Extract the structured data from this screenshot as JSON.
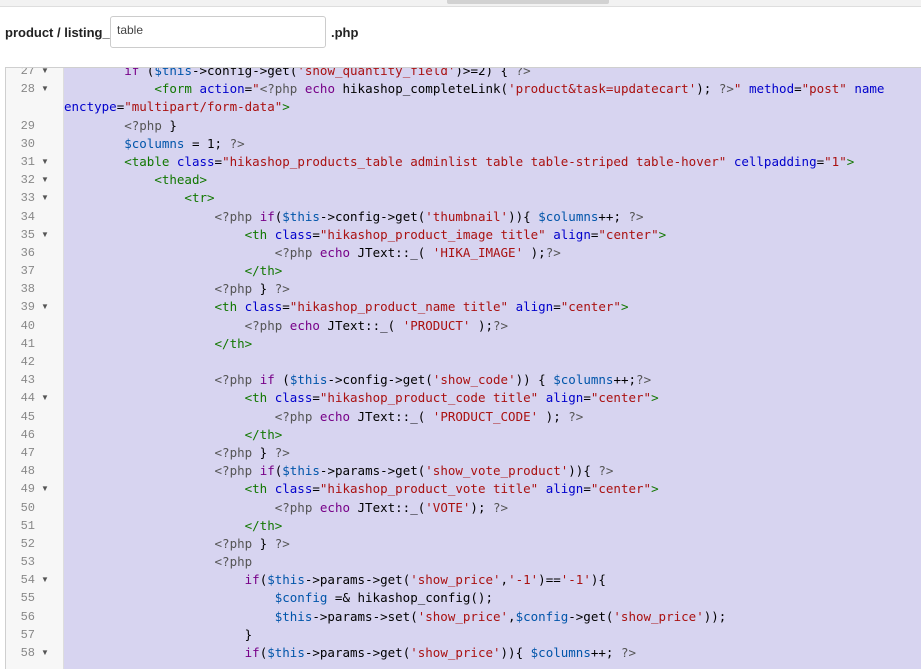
{
  "path": {
    "prefix": "product / listing_",
    "input_value": "table",
    "suffix": ".php"
  },
  "editor": {
    "lines": [
      {
        "num": "27",
        "fold": true,
        "segments": [
          [
            "plain",
            "        "
          ],
          [
            "kw",
            "if"
          ],
          [
            "plain",
            " ("
          ],
          [
            "var",
            "$this"
          ],
          [
            "plain",
            "->config->get("
          ],
          [
            "str",
            "'show_quantity_field'"
          ],
          [
            "plain",
            ")>=2) { "
          ],
          [
            "meta",
            "?>"
          ]
        ]
      },
      {
        "num": "28",
        "fold": true,
        "segments": [
          [
            "plain",
            "            "
          ],
          [
            "tag",
            "<form"
          ],
          [
            "plain",
            " "
          ],
          [
            "attr",
            "action"
          ],
          [
            "plain",
            "="
          ],
          [
            "str",
            "\""
          ],
          [
            "meta",
            "<?php"
          ],
          [
            "plain",
            " "
          ],
          [
            "kw",
            "echo"
          ],
          [
            "plain",
            " hikashop_completeLink("
          ],
          [
            "str",
            "'product&task=updatecart'"
          ],
          [
            "plain",
            "); "
          ],
          [
            "meta",
            "?>"
          ],
          [
            "str",
            "\""
          ],
          [
            "plain",
            " "
          ],
          [
            "attr",
            "method"
          ],
          [
            "plain",
            "="
          ],
          [
            "str",
            "\"post\""
          ],
          [
            "plain",
            " "
          ],
          [
            "attr",
            "name"
          ]
        ]
      },
      {
        "num": "",
        "fold": false,
        "segments": [
          [
            "attr",
            "enctype"
          ],
          [
            "plain",
            "="
          ],
          [
            "str",
            "\"multipart/form-data\""
          ],
          [
            "tag",
            ">"
          ]
        ]
      },
      {
        "num": "29",
        "fold": false,
        "segments": [
          [
            "plain",
            "        "
          ],
          [
            "meta",
            "<?php"
          ],
          [
            "plain",
            " }"
          ]
        ]
      },
      {
        "num": "30",
        "fold": false,
        "segments": [
          [
            "plain",
            "        "
          ],
          [
            "var",
            "$columns"
          ],
          [
            "plain",
            " = 1; "
          ],
          [
            "meta",
            "?>"
          ]
        ]
      },
      {
        "num": "31",
        "fold": true,
        "segments": [
          [
            "plain",
            "        "
          ],
          [
            "tag",
            "<table"
          ],
          [
            "plain",
            " "
          ],
          [
            "attr",
            "class"
          ],
          [
            "plain",
            "="
          ],
          [
            "str",
            "\"hikashop_products_table adminlist table table-striped table-hover\""
          ],
          [
            "plain",
            " "
          ],
          [
            "attr",
            "cellpadding"
          ],
          [
            "plain",
            "="
          ],
          [
            "str",
            "\"1\""
          ],
          [
            "tag",
            ">"
          ]
        ]
      },
      {
        "num": "32",
        "fold": true,
        "segments": [
          [
            "plain",
            "            "
          ],
          [
            "tag",
            "<thead>"
          ]
        ]
      },
      {
        "num": "33",
        "fold": true,
        "segments": [
          [
            "plain",
            "                "
          ],
          [
            "tag",
            "<tr>"
          ]
        ]
      },
      {
        "num": "34",
        "fold": false,
        "segments": [
          [
            "plain",
            "                    "
          ],
          [
            "meta",
            "<?php"
          ],
          [
            "plain",
            " "
          ],
          [
            "kw",
            "if"
          ],
          [
            "plain",
            "("
          ],
          [
            "var",
            "$this"
          ],
          [
            "plain",
            "->config->get("
          ],
          [
            "str",
            "'thumbnail'"
          ],
          [
            "plain",
            ")){ "
          ],
          [
            "var",
            "$columns"
          ],
          [
            "plain",
            "++; "
          ],
          [
            "meta",
            "?>"
          ]
        ]
      },
      {
        "num": "35",
        "fold": true,
        "segments": [
          [
            "plain",
            "                        "
          ],
          [
            "tag",
            "<th"
          ],
          [
            "plain",
            " "
          ],
          [
            "attr",
            "class"
          ],
          [
            "plain",
            "="
          ],
          [
            "str",
            "\"hikashop_product_image title\""
          ],
          [
            "plain",
            " "
          ],
          [
            "attr",
            "align"
          ],
          [
            "plain",
            "="
          ],
          [
            "str",
            "\"center\""
          ],
          [
            "tag",
            ">"
          ]
        ]
      },
      {
        "num": "36",
        "fold": false,
        "segments": [
          [
            "plain",
            "                            "
          ],
          [
            "meta",
            "<?php"
          ],
          [
            "plain",
            " "
          ],
          [
            "kw",
            "echo"
          ],
          [
            "plain",
            " JText::_( "
          ],
          [
            "str",
            "'HIKA_IMAGE'"
          ],
          [
            "plain",
            " );"
          ],
          [
            "meta",
            "?>"
          ]
        ]
      },
      {
        "num": "37",
        "fold": false,
        "segments": [
          [
            "plain",
            "                        "
          ],
          [
            "tag",
            "</th>"
          ]
        ]
      },
      {
        "num": "38",
        "fold": false,
        "segments": [
          [
            "plain",
            "                    "
          ],
          [
            "meta",
            "<?php"
          ],
          [
            "plain",
            " } "
          ],
          [
            "meta",
            "?>"
          ]
        ]
      },
      {
        "num": "39",
        "fold": true,
        "segments": [
          [
            "plain",
            "                    "
          ],
          [
            "tag",
            "<th"
          ],
          [
            "plain",
            " "
          ],
          [
            "attr",
            "class"
          ],
          [
            "plain",
            "="
          ],
          [
            "str",
            "\"hikashop_product_name title\""
          ],
          [
            "plain",
            " "
          ],
          [
            "attr",
            "align"
          ],
          [
            "plain",
            "="
          ],
          [
            "str",
            "\"center\""
          ],
          [
            "tag",
            ">"
          ]
        ]
      },
      {
        "num": "40",
        "fold": false,
        "segments": [
          [
            "plain",
            "                        "
          ],
          [
            "meta",
            "<?php"
          ],
          [
            "plain",
            " "
          ],
          [
            "kw",
            "echo"
          ],
          [
            "plain",
            " JText::_( "
          ],
          [
            "str",
            "'PRODUCT'"
          ],
          [
            "plain",
            " );"
          ],
          [
            "meta",
            "?>"
          ]
        ]
      },
      {
        "num": "41",
        "fold": false,
        "segments": [
          [
            "plain",
            "                    "
          ],
          [
            "tag",
            "</th>"
          ]
        ]
      },
      {
        "num": "42",
        "fold": false,
        "segments": []
      },
      {
        "num": "43",
        "fold": false,
        "segments": [
          [
            "plain",
            "                    "
          ],
          [
            "meta",
            "<?php"
          ],
          [
            "plain",
            " "
          ],
          [
            "kw",
            "if"
          ],
          [
            "plain",
            " ("
          ],
          [
            "var",
            "$this"
          ],
          [
            "plain",
            "->config->get("
          ],
          [
            "str",
            "'show_code'"
          ],
          [
            "plain",
            ")) { "
          ],
          [
            "var",
            "$columns"
          ],
          [
            "plain",
            "++;"
          ],
          [
            "meta",
            "?>"
          ]
        ]
      },
      {
        "num": "44",
        "fold": true,
        "segments": [
          [
            "plain",
            "                        "
          ],
          [
            "tag",
            "<th"
          ],
          [
            "plain",
            " "
          ],
          [
            "attr",
            "class"
          ],
          [
            "plain",
            "="
          ],
          [
            "str",
            "\"hikashop_product_code title\""
          ],
          [
            "plain",
            " "
          ],
          [
            "attr",
            "align"
          ],
          [
            "plain",
            "="
          ],
          [
            "str",
            "\"center\""
          ],
          [
            "tag",
            ">"
          ]
        ]
      },
      {
        "num": "45",
        "fold": false,
        "segments": [
          [
            "plain",
            "                            "
          ],
          [
            "meta",
            "<?php"
          ],
          [
            "plain",
            " "
          ],
          [
            "kw",
            "echo"
          ],
          [
            "plain",
            " JText::_( "
          ],
          [
            "str",
            "'PRODUCT_CODE'"
          ],
          [
            "plain",
            " ); "
          ],
          [
            "meta",
            "?>"
          ]
        ]
      },
      {
        "num": "46",
        "fold": false,
        "segments": [
          [
            "plain",
            "                        "
          ],
          [
            "tag",
            "</th>"
          ]
        ]
      },
      {
        "num": "47",
        "fold": false,
        "segments": [
          [
            "plain",
            "                    "
          ],
          [
            "meta",
            "<?php"
          ],
          [
            "plain",
            " } "
          ],
          [
            "meta",
            "?>"
          ]
        ]
      },
      {
        "num": "48",
        "fold": false,
        "segments": [
          [
            "plain",
            "                    "
          ],
          [
            "meta",
            "<?php"
          ],
          [
            "plain",
            " "
          ],
          [
            "kw",
            "if"
          ],
          [
            "plain",
            "("
          ],
          [
            "var",
            "$this"
          ],
          [
            "plain",
            "->params->get("
          ],
          [
            "str",
            "'show_vote_product'"
          ],
          [
            "plain",
            ")){ "
          ],
          [
            "meta",
            "?>"
          ]
        ]
      },
      {
        "num": "49",
        "fold": true,
        "segments": [
          [
            "plain",
            "                        "
          ],
          [
            "tag",
            "<th"
          ],
          [
            "plain",
            " "
          ],
          [
            "attr",
            "class"
          ],
          [
            "plain",
            "="
          ],
          [
            "str",
            "\"hikashop_product_vote title\""
          ],
          [
            "plain",
            " "
          ],
          [
            "attr",
            "align"
          ],
          [
            "plain",
            "="
          ],
          [
            "str",
            "\"center\""
          ],
          [
            "tag",
            ">"
          ]
        ]
      },
      {
        "num": "50",
        "fold": false,
        "segments": [
          [
            "plain",
            "                            "
          ],
          [
            "meta",
            "<?php"
          ],
          [
            "plain",
            " "
          ],
          [
            "kw",
            "echo"
          ],
          [
            "plain",
            " JText::_("
          ],
          [
            "str",
            "'VOTE'"
          ],
          [
            "plain",
            "); "
          ],
          [
            "meta",
            "?>"
          ]
        ]
      },
      {
        "num": "51",
        "fold": false,
        "segments": [
          [
            "plain",
            "                        "
          ],
          [
            "tag",
            "</th>"
          ]
        ]
      },
      {
        "num": "52",
        "fold": false,
        "segments": [
          [
            "plain",
            "                    "
          ],
          [
            "meta",
            "<?php"
          ],
          [
            "plain",
            " } "
          ],
          [
            "meta",
            "?>"
          ]
        ]
      },
      {
        "num": "53",
        "fold": false,
        "segments": [
          [
            "plain",
            "                    "
          ],
          [
            "meta",
            "<?php"
          ]
        ]
      },
      {
        "num": "54",
        "fold": true,
        "segments": [
          [
            "plain",
            "                        "
          ],
          [
            "kw",
            "if"
          ],
          [
            "plain",
            "("
          ],
          [
            "var",
            "$this"
          ],
          [
            "plain",
            "->params->get("
          ],
          [
            "str",
            "'show_price'"
          ],
          [
            "plain",
            ","
          ],
          [
            "str",
            "'-1'"
          ],
          [
            "plain",
            ")=="
          ],
          [
            "str",
            "'-1'"
          ],
          [
            "plain",
            "){"
          ]
        ]
      },
      {
        "num": "55",
        "fold": false,
        "segments": [
          [
            "plain",
            "                            "
          ],
          [
            "var",
            "$config"
          ],
          [
            "plain",
            " =& hikashop_config();"
          ]
        ]
      },
      {
        "num": "56",
        "fold": false,
        "segments": [
          [
            "plain",
            "                            "
          ],
          [
            "var",
            "$this"
          ],
          [
            "plain",
            "->params->set("
          ],
          [
            "str",
            "'show_price'"
          ],
          [
            "plain",
            ","
          ],
          [
            "var",
            "$config"
          ],
          [
            "plain",
            "->get("
          ],
          [
            "str",
            "'show_price'"
          ],
          [
            "plain",
            "));"
          ]
        ]
      },
      {
        "num": "57",
        "fold": false,
        "segments": [
          [
            "plain",
            "                        }"
          ]
        ]
      },
      {
        "num": "58",
        "fold": true,
        "segments": [
          [
            "plain",
            "                        "
          ],
          [
            "kw",
            "if"
          ],
          [
            "plain",
            "("
          ],
          [
            "var",
            "$this"
          ],
          [
            "plain",
            "->params->get("
          ],
          [
            "str",
            "'show_price'"
          ],
          [
            "plain",
            ")){ "
          ],
          [
            "var",
            "$columns"
          ],
          [
            "plain",
            "++; "
          ],
          [
            "meta",
            "?>"
          ]
        ]
      }
    ]
  }
}
